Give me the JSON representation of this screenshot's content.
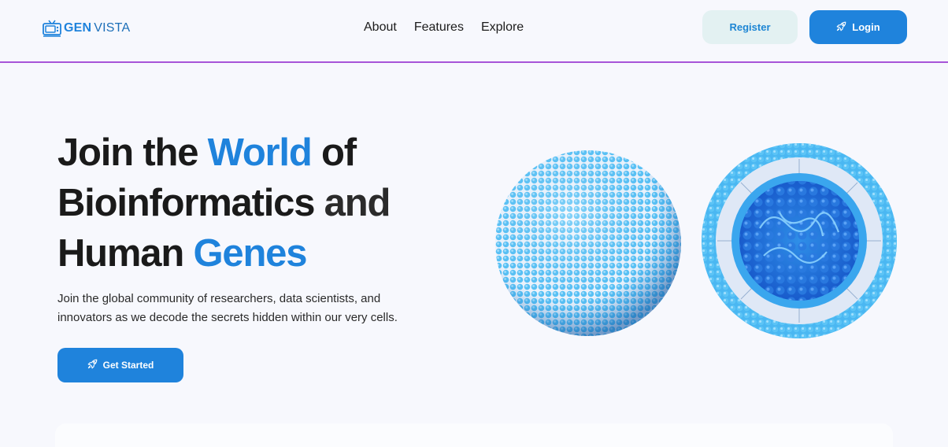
{
  "header": {
    "logo": {
      "gen": "GEN",
      "vista": "VISTA",
      "icon": "tv-icon"
    },
    "nav": [
      {
        "label": "About"
      },
      {
        "label": "Features"
      },
      {
        "label": "Explore"
      }
    ],
    "register_label": "Register",
    "login_label": "Login",
    "login_icon": "rocket-icon"
  },
  "hero": {
    "headline": {
      "join_the": "Join the ",
      "world": "World",
      "of": " of",
      "bioinformatics": "Bioinformatics",
      "and": " and",
      "human": "Human ",
      "genes": "Genes"
    },
    "subtext": "Join the global community of researchers, data scientists, and innovators as we decode the secrets hidden within our very cells.",
    "cta_label": "Get Started",
    "cta_icon": "rocket-icon",
    "image": "liposome-spheres-illustration"
  },
  "colors": {
    "accent": "#1f83dc",
    "divider": "#a755d8",
    "register_bg": "#e3f1f2",
    "page_bg": "#f7f8fd"
  }
}
